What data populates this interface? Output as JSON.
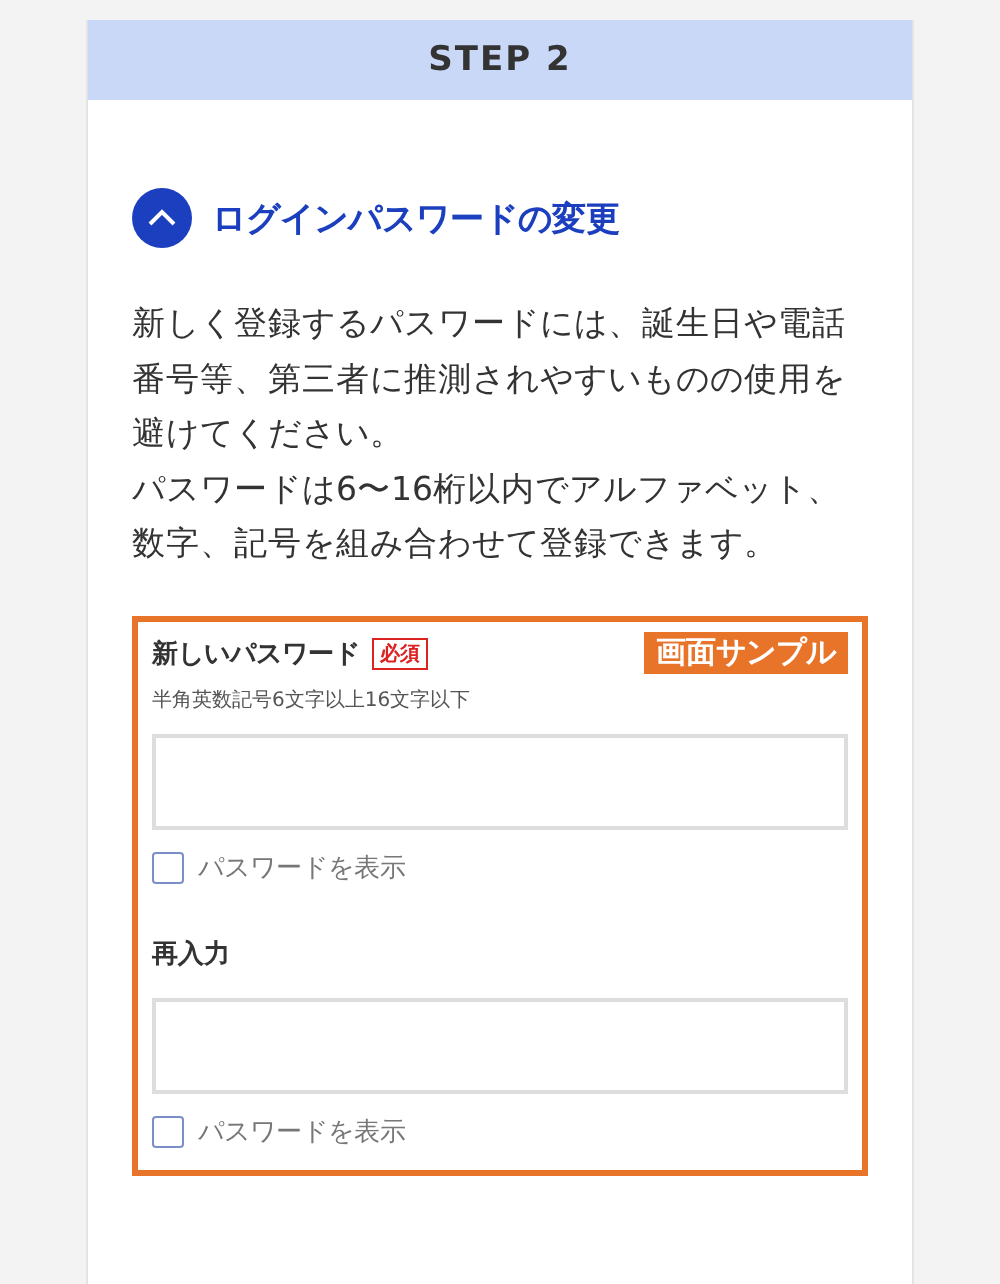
{
  "step": {
    "title": "STEP 2"
  },
  "section": {
    "title": "ログインパスワードの変更",
    "expanded": true
  },
  "description": [
    "新しく登録するパスワードには、誕生日や電話番号等、第三者に推測されやすいものの使用を避けてください。",
    "パスワードは6〜16桁以内でアルファベット、数字、記号を組み合わせて登録できます。"
  ],
  "sample": {
    "badge": "画面サンプル",
    "fields": [
      {
        "label": "新しいパスワード",
        "required_tag": "必須",
        "hint": "半角英数記号6文字以上16文字以下",
        "show_password": {
          "label": "パスワードを表示",
          "checked": false
        }
      },
      {
        "label": "再入力",
        "show_password": {
          "label": "パスワードを表示",
          "checked": false
        }
      }
    ]
  }
}
